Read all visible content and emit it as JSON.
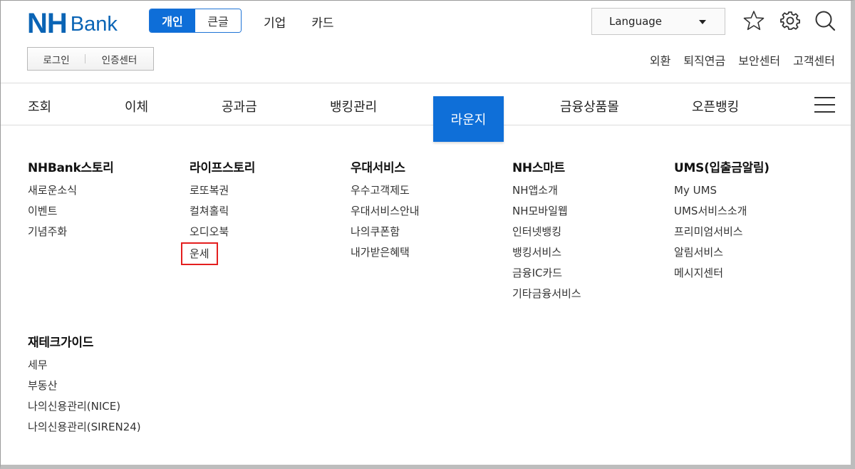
{
  "header": {
    "logo_primary": "NH",
    "logo_secondary": "Bank",
    "segment": [
      {
        "label": "개인",
        "active": true
      },
      {
        "label": "큰글",
        "active": false
      }
    ],
    "top_links": [
      "기업",
      "카드"
    ],
    "language_label": "Language",
    "icons": [
      "star-icon",
      "gear-icon",
      "search-icon"
    ],
    "auth": {
      "login": "로그인",
      "cert_center": "인증센터"
    },
    "util_links": [
      "외환",
      "퇴직연금",
      "보안센터",
      "고객센터"
    ]
  },
  "gnb": {
    "items": [
      "조회",
      "이체",
      "공과금",
      "뱅킹관리",
      "라운지",
      "금융상품몰",
      "오픈뱅킹"
    ],
    "active": "라운지",
    "menu_icon": "hamburger-icon"
  },
  "mega_menu": {
    "columns": [
      {
        "title": "NHBank스토리",
        "items": [
          "새로운소식",
          "이벤트",
          "기념주화"
        ]
      },
      {
        "title": "라이프스토리",
        "items": [
          "로또복권",
          "컬쳐홀릭",
          "오디오북",
          "운세"
        ],
        "highlighted": "운세"
      },
      {
        "title": "우대서비스",
        "items": [
          "우수고객제도",
          "우대서비스안내",
          "나의쿠폰함",
          "내가받은혜택"
        ]
      },
      {
        "title": "NH스마트",
        "items": [
          "NH앱소개",
          "NH모바일웹",
          "인터넷뱅킹",
          "뱅킹서비스",
          "금융IC카드",
          "기타금융서비스"
        ]
      },
      {
        "title": "UMS(입출금알림)",
        "items": [
          "My UMS",
          "UMS서비스소개",
          "프리미엄서비스",
          "알림서비스",
          "메시지센터"
        ]
      },
      {
        "title": "재테크가이드",
        "items": [
          "세무",
          "부동산",
          "나의신용관리(NICE)",
          "나의신용관리(SIREN24)"
        ]
      }
    ]
  },
  "colors": {
    "brand": "#0a64b5",
    "active_tab": "#0f6fd8",
    "highlight_border": "#e41f1f"
  }
}
